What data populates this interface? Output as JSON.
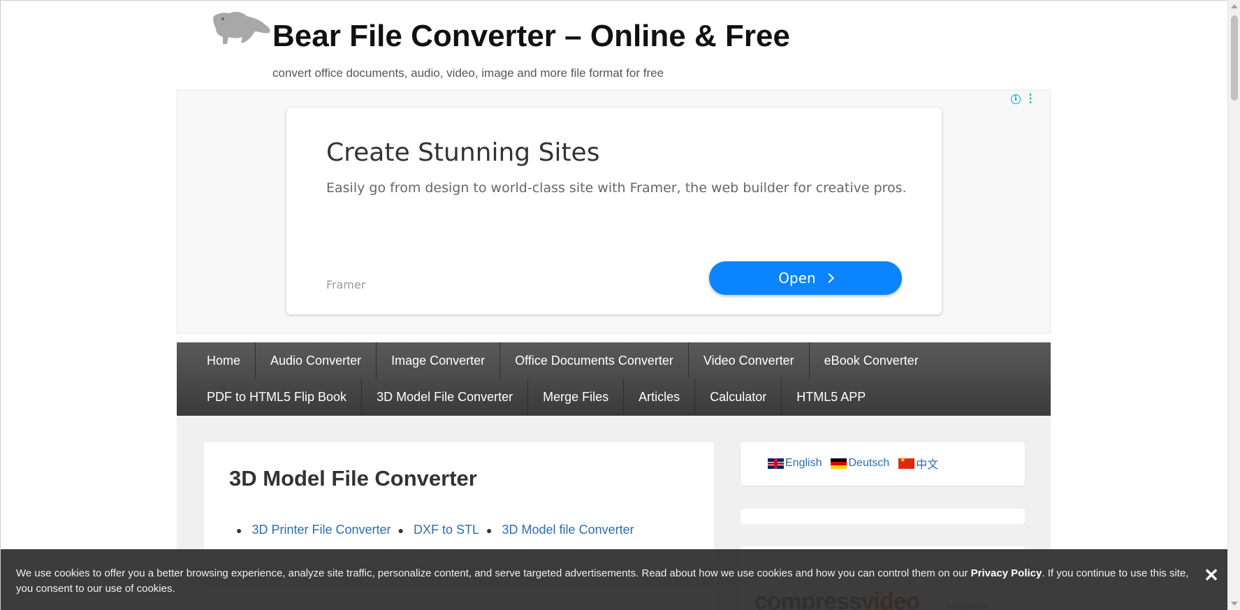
{
  "header": {
    "title": "Bear File Converter – Online & Free",
    "tagline": "convert office documents, audio, video, image and more file format for free",
    "logo_icon": "bear-logo-icon"
  },
  "ad": {
    "headline": "Create Stunning Sites",
    "description": "Easily go from design to world-class site with Framer, the web builder for creative pros.",
    "brand": "Framer",
    "button_label": "Open",
    "accent_color": "#0a84ff"
  },
  "nav": {
    "row1": [
      "Home",
      "Audio Converter",
      "Image Converter",
      "Office Documents Converter",
      "Video Converter",
      "eBook Converter"
    ],
    "row2": [
      "PDF to HTML5 Flip Book",
      "3D Model File Converter",
      "Merge Files",
      "Articles",
      "Calculator",
      "HTML5 APP"
    ]
  },
  "main": {
    "title": "3D Model File Converter",
    "links": [
      "3D Printer File Converter",
      "DXF to STL",
      "3D Model file Converter"
    ]
  },
  "sidebar": {
    "languages": [
      {
        "label": "English",
        "flag": "uk-flag-icon"
      },
      {
        "label": "Deutsch",
        "flag": "germany-flag-icon"
      },
      {
        "label": "中文",
        "flag": "china-flag-icon"
      }
    ],
    "promo_logo_a": "compress",
    "promo_logo_b": "video",
    "promo_small": "compress"
  },
  "cookie": {
    "text_before": "We use cookies to offer you a better browsing experience, analyze site traffic, personalize content, and serve targeted advertisements. Read about how we use cookies and how you can control them on our ",
    "link": "Privacy Policy",
    "text_after": ". If you continue to use this site, you consent to our use of cookies.",
    "close_label": "✕"
  }
}
